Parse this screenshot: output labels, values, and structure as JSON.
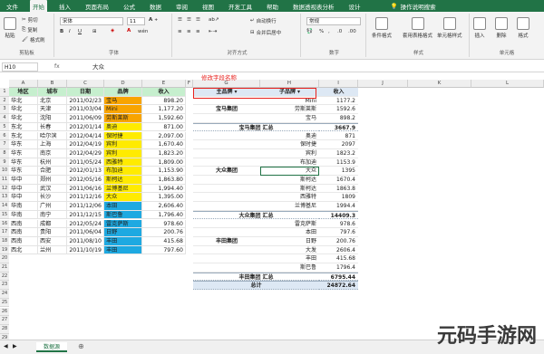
{
  "menu": {
    "tabs": [
      "文件",
      "开始",
      "插入",
      "页面布局",
      "公式",
      "数据",
      "审阅",
      "视图",
      "开发工具",
      "帮助"
    ],
    "special_tabs": [
      "数据透视表分析",
      "设计"
    ],
    "search": "操作说明搜索"
  },
  "ribbon": {
    "paste": "粘贴",
    "cut": "剪切",
    "copy": "复制",
    "format_painter": "格式刷",
    "clipboard": "剪贴板",
    "font_name": "宋体",
    "font_size": "11",
    "font_group": "字体",
    "wrap_text": "自动换行",
    "merge_center": "合并后居中",
    "alignment": "对齐方式",
    "number_format": "常规",
    "number": "数字",
    "conditional_format": "条件格式",
    "table_format": "套用表格格式",
    "cell_styles": "单元格样式",
    "styles": "样式",
    "insert": "插入",
    "delete": "删除",
    "format": "格式",
    "cells": "单元格"
  },
  "formula_bar": {
    "name_box": "H10",
    "fx": "fx",
    "value": "大众"
  },
  "columns": [
    "A",
    "B",
    "C",
    "D",
    "E",
    "F",
    "G",
    "H",
    "I",
    "J",
    "K",
    "L"
  ],
  "rows": [
    "1",
    "2",
    "3",
    "4",
    "5",
    "6",
    "7",
    "8",
    "9",
    "10",
    "11",
    "12",
    "13",
    "14",
    "15",
    "16",
    "17",
    "18",
    "19",
    "20",
    "21",
    "22",
    "23",
    "24",
    "25",
    "26",
    "27",
    "28",
    "29"
  ],
  "table": {
    "headers": [
      "地区",
      "城市",
      "日期",
      "品牌",
      "收入"
    ],
    "rows": [
      [
        "华北",
        "北京",
        "2011/02/23",
        "宝马",
        "898.20"
      ],
      [
        "华北",
        "天津",
        "2011/03/04",
        "Mini",
        "1,177.20"
      ],
      [
        "华北",
        "沈阳",
        "2011/06/09",
        "劳斯莱斯",
        "1,592.60"
      ],
      [
        "东北",
        "长春",
        "2012/01/14",
        "奥迪",
        "871.00"
      ],
      [
        "东北",
        "哈尔滨",
        "2012/04/14",
        "保时捷",
        "2,097.00"
      ],
      [
        "华东",
        "上海",
        "2012/04/19",
        "宾利",
        "1,670.40"
      ],
      [
        "华东",
        "南京",
        "2012/04/29",
        "宾利",
        "1,823.20"
      ],
      [
        "华东",
        "杭州",
        "2011/05/24",
        "西雅特",
        "1,809.00"
      ],
      [
        "华东",
        "合肥",
        "2012/01/13",
        "布加迪",
        "1,153.90"
      ],
      [
        "华中",
        "郑州",
        "2012/05/16",
        "斯柯达",
        "1,863.80"
      ],
      [
        "华中",
        "武汉",
        "2011/06/16",
        "兰博基尼",
        "1,994.40"
      ],
      [
        "华中",
        "长沙",
        "2011/12/16",
        "大众",
        "1,395.00"
      ],
      [
        "华南",
        "广州",
        "2011/12/06",
        "本田",
        "2,606.40"
      ],
      [
        "华南",
        "南宁",
        "2011/12/15",
        "斯巴鲁",
        "1,796.40"
      ],
      [
        "西南",
        "成都",
        "2012/05/24",
        "雷克萨斯",
        "978.60"
      ],
      [
        "西南",
        "贵阳",
        "2011/06/04",
        "日野",
        "200.76"
      ],
      [
        "西南",
        "西安",
        "2011/08/10",
        "丰田",
        "415.68"
      ],
      [
        "西北",
        "兰州",
        "2011/10/19",
        "丰田",
        "797.60"
      ]
    ],
    "brand_colors": [
      "orange",
      "orange",
      "orange",
      "yellow",
      "yellow",
      "yellow",
      "yellow",
      "yellow",
      "yellow",
      "yellow",
      "yellow",
      "yellow",
      "blue",
      "blue",
      "blue",
      "blue",
      "blue",
      "blue"
    ]
  },
  "annotation": "修改字段名称",
  "pivot": {
    "headers": [
      "主品牌",
      "子品牌",
      "收入"
    ],
    "rows": [
      [
        "",
        "Mini",
        "1177.2"
      ],
      [
        "宝马集团",
        "劳斯莱斯",
        "1592.6"
      ],
      [
        "",
        "宝马",
        "898.2"
      ],
      [
        "宝马集团 汇总",
        "",
        "3667.9"
      ],
      [
        "",
        "奥迪",
        "871"
      ],
      [
        "",
        "保时捷",
        "2097"
      ],
      [
        "",
        "宾利",
        "1823.2"
      ],
      [
        "",
        "布加迪",
        "1153.9"
      ],
      [
        "大众集团",
        "大众",
        "1395"
      ],
      [
        "",
        "斯柯达",
        "1670.4"
      ],
      [
        "",
        "斯柯达",
        "1863.8"
      ],
      [
        "",
        "西雅特",
        "1809"
      ],
      [
        "",
        "兰博基尼",
        "1994.4"
      ],
      [
        "大众集团 汇总",
        "",
        "14409.3"
      ],
      [
        "",
        "雷克萨斯",
        "978.6"
      ],
      [
        "",
        "本田",
        "797.6"
      ],
      [
        "丰田集团",
        "日野",
        "200.76"
      ],
      [
        "",
        "大发",
        "2606.4"
      ],
      [
        "",
        "丰田",
        "415.68"
      ],
      [
        "",
        "斯巴鲁",
        "1796.4"
      ],
      [
        "丰田集团 汇总",
        "",
        "6795.44"
      ],
      [
        "总计",
        "",
        "24872.64"
      ]
    ]
  },
  "sheet_tab": "数据源",
  "watermark": "元码手游网"
}
